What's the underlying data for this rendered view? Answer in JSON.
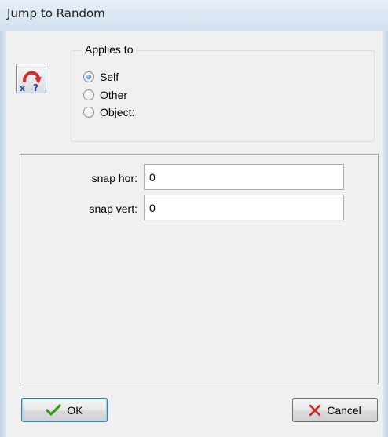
{
  "window": {
    "title": "Jump to Random"
  },
  "action": {
    "icon": "jump-to-random-icon"
  },
  "applies_to": {
    "legend": "Applies to",
    "options": [
      {
        "label": "Self",
        "checked": true
      },
      {
        "label": "Other",
        "checked": false
      },
      {
        "label": "Object:",
        "checked": false
      }
    ]
  },
  "params": [
    {
      "label": "snap hor:",
      "value": "0"
    },
    {
      "label": "snap vert:",
      "value": "0"
    }
  ],
  "buttons": {
    "ok": {
      "label": "OK",
      "icon": "checkmark-icon"
    },
    "cancel": {
      "label": "Cancel",
      "icon": "red-x-icon"
    }
  },
  "colors": {
    "check_green": "#3a9a1c",
    "cancel_red": "#d42020",
    "arrow_red": "#d52b2b",
    "icon_blue": "#2346b0",
    "radio_selected": "#1a62b8"
  }
}
